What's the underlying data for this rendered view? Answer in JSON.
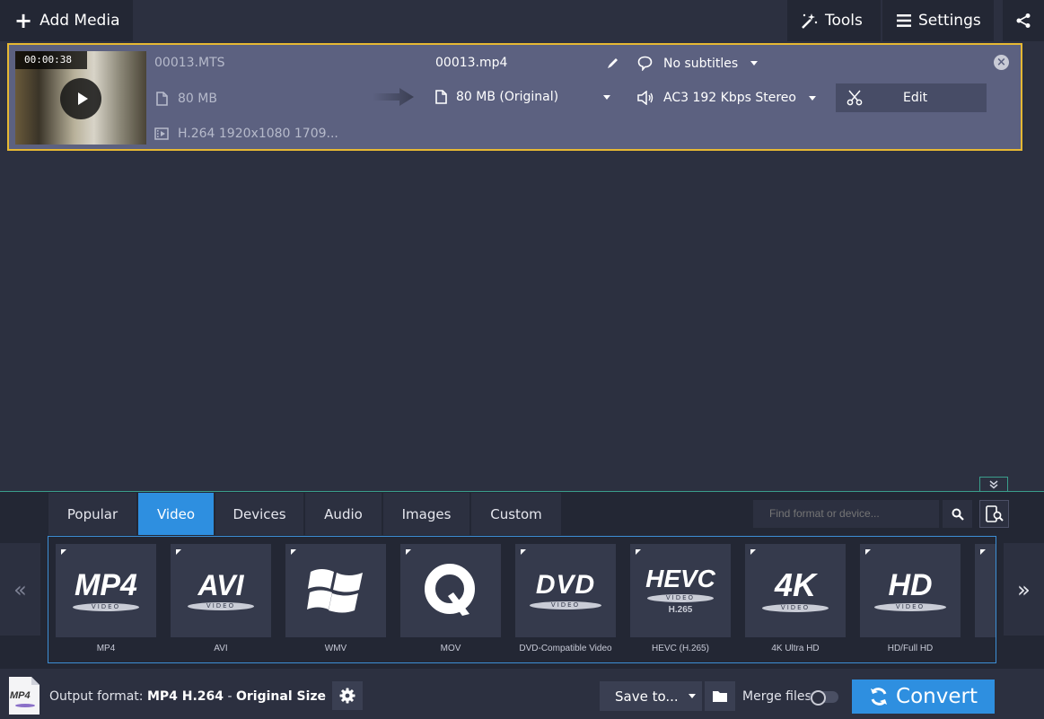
{
  "topbar": {
    "add_media": "Add Media",
    "tools": "Tools",
    "settings": "Settings"
  },
  "file": {
    "duration": "00:00:38",
    "source_name": "00013.MTS",
    "source_size": "80 MB",
    "source_codec": "H.264 1920x1080 1709...",
    "output_name": "00013.mp4",
    "output_size": "80 MB (Original)",
    "subtitles": "No subtitles",
    "audio": "AC3 192 Kbps Stereo",
    "edit_label": "Edit"
  },
  "tabs": [
    "Popular",
    "Video",
    "Devices",
    "Audio",
    "Images",
    "Custom"
  ],
  "active_tab": "Video",
  "search": {
    "placeholder": "Find format or device..."
  },
  "formats": [
    {
      "logo": "MP4",
      "sub": "VIDEO",
      "label": "MP4"
    },
    {
      "logo": "AVI",
      "sub": "VIDEO",
      "label": "AVI"
    },
    {
      "logo": "windows-logo",
      "sub": "",
      "label": "WMV"
    },
    {
      "logo": "quicktime-logo",
      "sub": "",
      "label": "MOV"
    },
    {
      "logo": "DVD",
      "sub": "VIDEO",
      "label": "DVD-Compatible Video"
    },
    {
      "logo": "HEVC",
      "sub": "VIDEO",
      "label": "HEVC (H.265)",
      "extra": "H.265"
    },
    {
      "logo": "4K",
      "sub": "VIDEO",
      "label": "4K Ultra HD"
    },
    {
      "logo": "HD",
      "sub": "VIDEO",
      "label": "HD/Full HD"
    }
  ],
  "nav": {
    "prev": "«",
    "next": "»"
  },
  "status": {
    "file_badge": "MP4",
    "output_prefix": "Output format: ",
    "output_format": "MP4 H.264",
    "separator": " - ",
    "output_size": "Original Size",
    "save_to": "Save to...",
    "merge": "Merge files",
    "convert": "Convert"
  },
  "colors": {
    "accent": "#2e8fe0",
    "selection": "#e6b833",
    "row": "#5c6180",
    "panel_line": "#3a9e8c"
  }
}
